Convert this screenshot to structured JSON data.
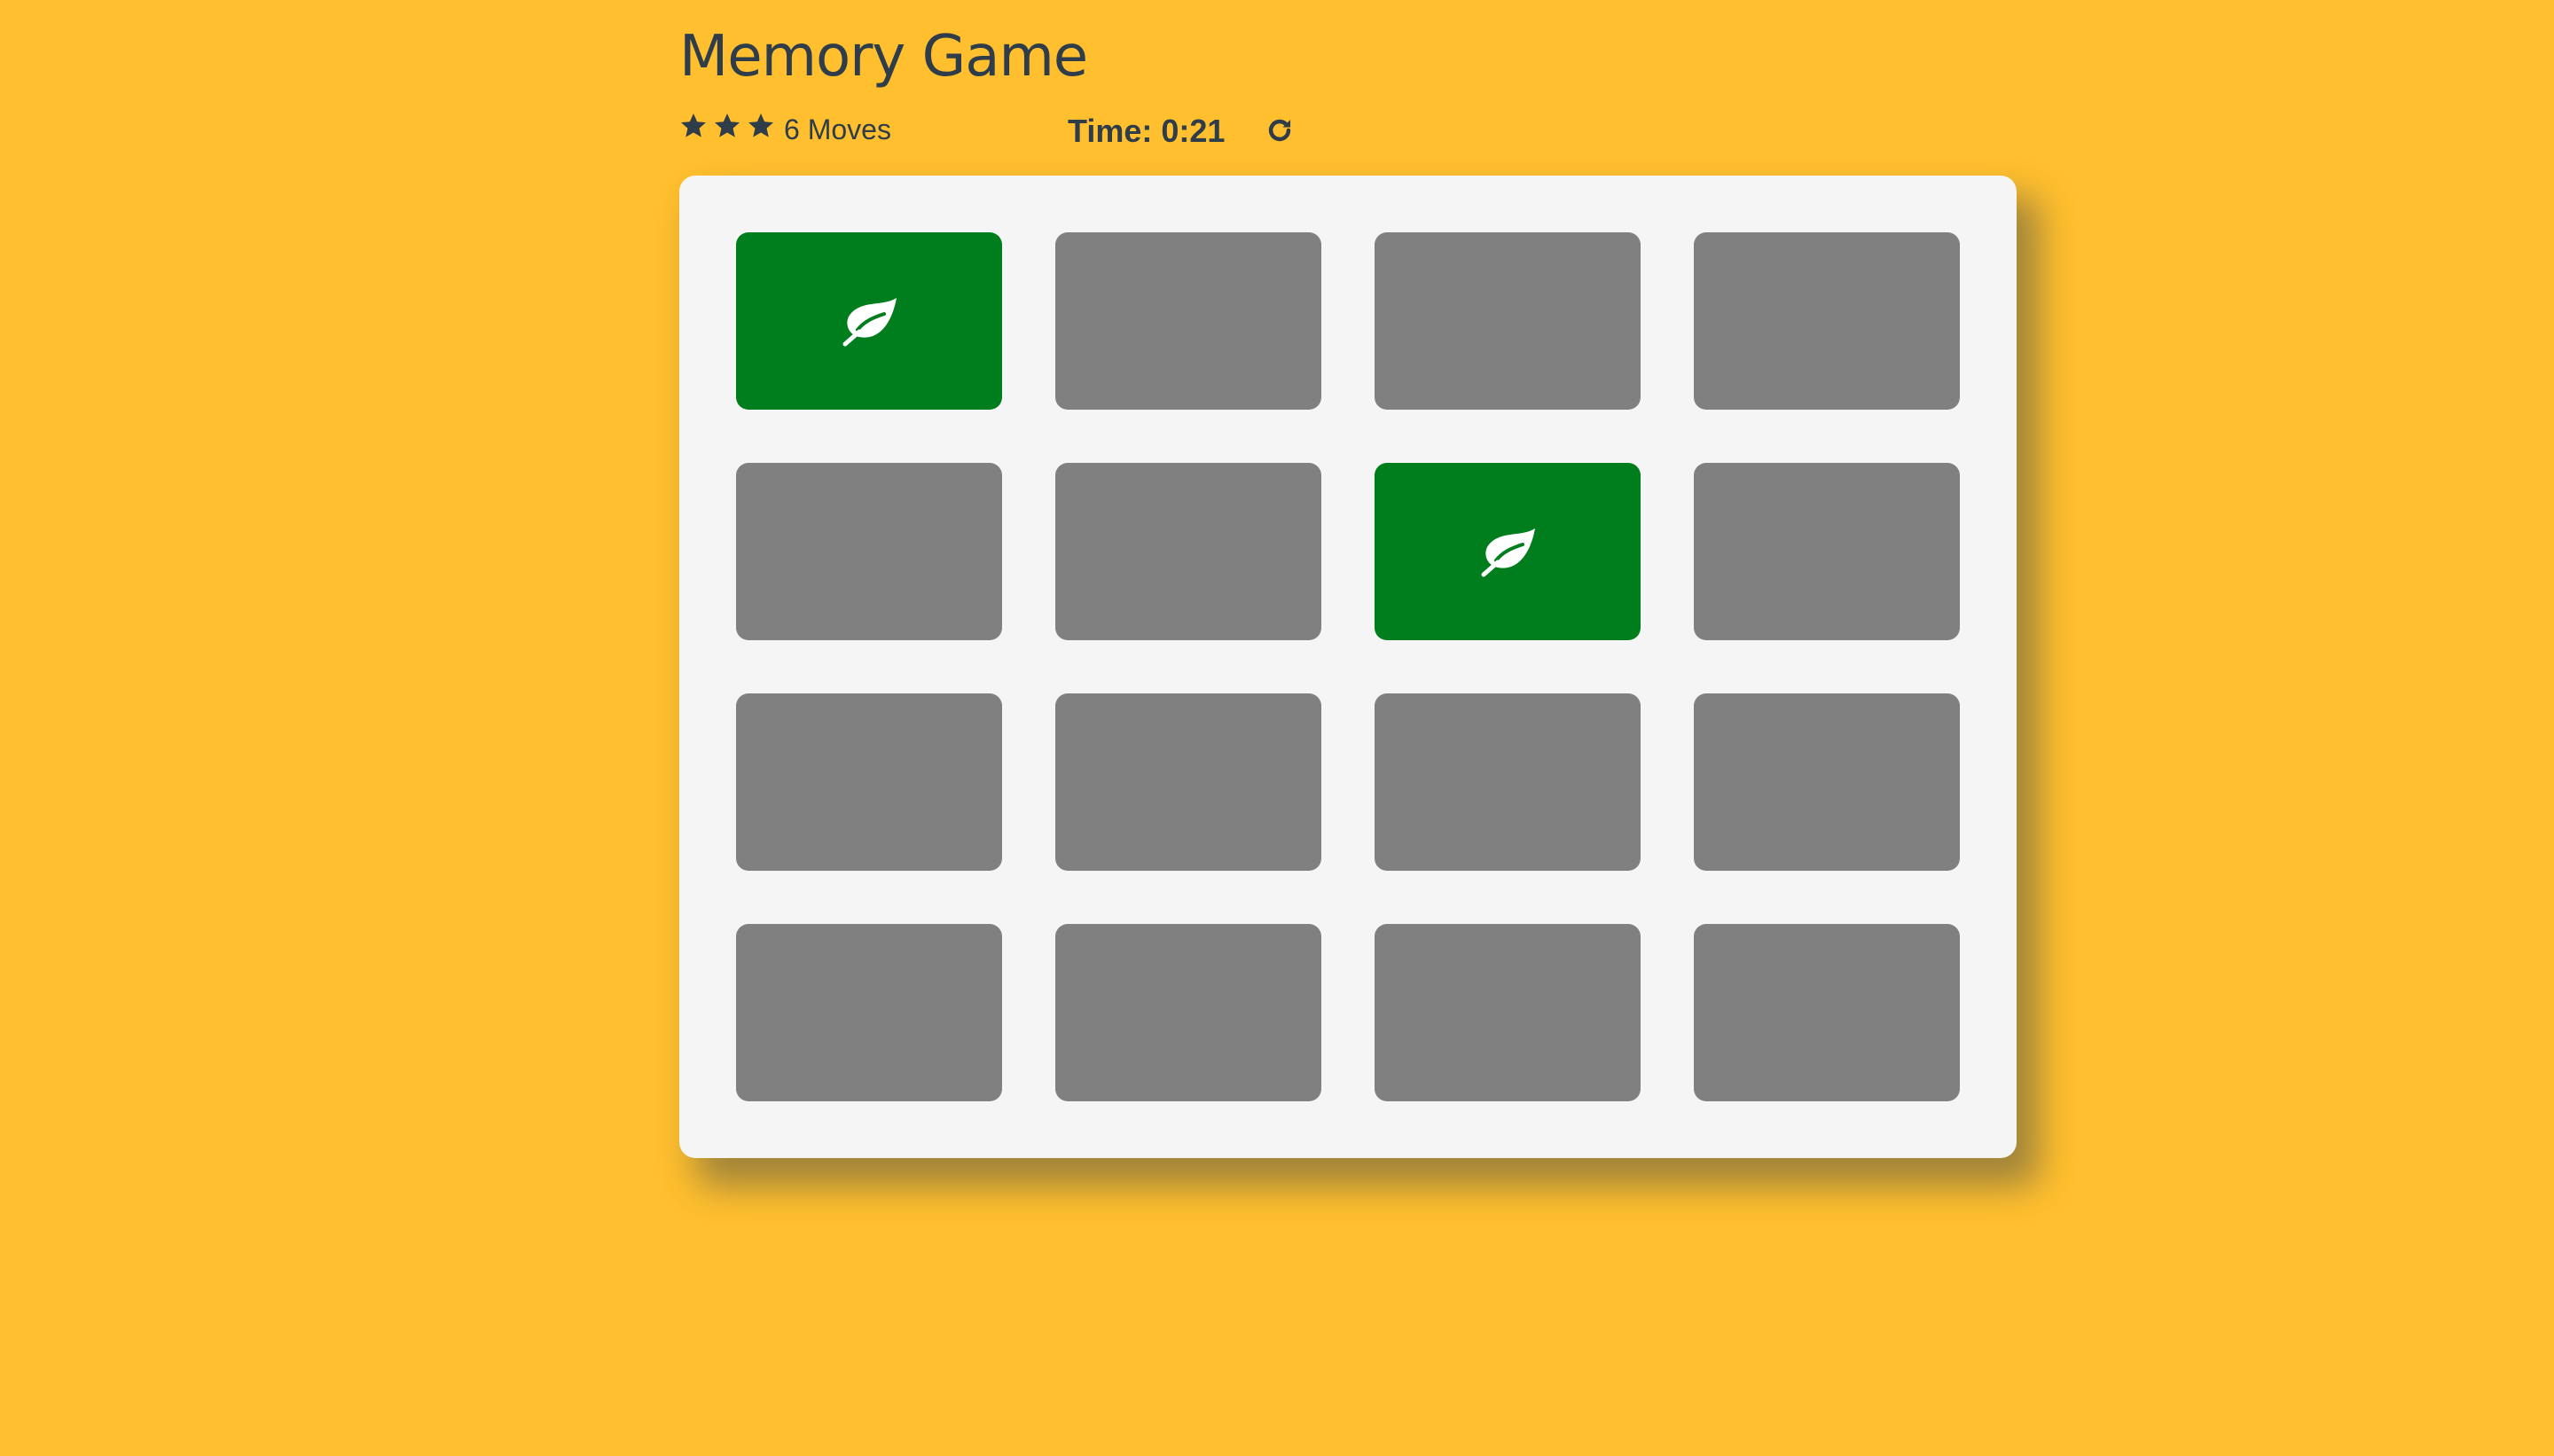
{
  "header": {
    "title": "Memory Game"
  },
  "score_panel": {
    "stars": [
      "star-icon",
      "star-icon",
      "star-icon"
    ],
    "moves_label": "6 Moves",
    "timer_label": "Time: 0:21",
    "restart_icon": "restart-icon"
  },
  "colors": {
    "background": "#FFBF2E",
    "board": "#f5f5f5",
    "card_hidden": "#808080",
    "card_open": "#007d1c",
    "text": "#2e3d49"
  },
  "deck": {
    "rows": 4,
    "columns": 4,
    "cards": [
      {
        "state": "open",
        "icon": "leaf-icon"
      },
      {
        "state": "hidden"
      },
      {
        "state": "hidden"
      },
      {
        "state": "hidden"
      },
      {
        "state": "hidden"
      },
      {
        "state": "hidden"
      },
      {
        "state": "open",
        "icon": "leaf-icon"
      },
      {
        "state": "hidden"
      },
      {
        "state": "hidden"
      },
      {
        "state": "hidden"
      },
      {
        "state": "hidden"
      },
      {
        "state": "hidden"
      },
      {
        "state": "hidden"
      },
      {
        "state": "hidden"
      },
      {
        "state": "hidden"
      },
      {
        "state": "hidden"
      }
    ]
  }
}
